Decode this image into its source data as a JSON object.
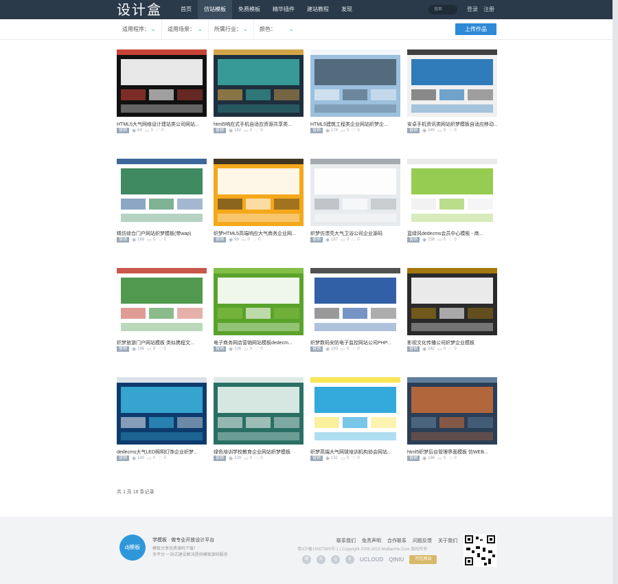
{
  "header": {
    "logo": "设计盒",
    "nav": [
      {
        "label": "首页",
        "active": false
      },
      {
        "label": "仿站模板",
        "active": true
      },
      {
        "label": "免费模板",
        "active": false
      },
      {
        "label": "精华插件",
        "active": false
      },
      {
        "label": "建站教程",
        "active": false
      },
      {
        "label": "发现",
        "active": false
      }
    ],
    "search_placeholder": "搜索",
    "login": "登录",
    "register": "注册"
  },
  "filters": [
    {
      "label": "适用程序：",
      "icon": "chevron-down-icon"
    },
    {
      "label": "适用场景：",
      "icon": "chevron-down-icon"
    },
    {
      "label": "所属行业：",
      "icon": "chevron-down-icon"
    },
    {
      "label": "颜色：",
      "icon": "chevron-down-icon"
    }
  ],
  "upload_button": "上传作品",
  "cards": [
    {
      "title": "HTML5大气网络设计建站类公司网站...",
      "tag": "营销",
      "views": "63",
      "comments": "0",
      "likes": "0",
      "theme": "#ffffff"
    },
    {
      "title": "html5响应式手机自适应资源共享类...",
      "tag": "营销",
      "views": "162",
      "comments": "0",
      "likes": "0",
      "theme": "#2b3e4e"
    },
    {
      "title": "HTML5建筑工程类企业网站织梦企...",
      "tag": "营销",
      "views": "174",
      "comments": "0",
      "likes": "0",
      "theme": "#5b7ea0"
    },
    {
      "title": "安卓手机资讯类网站织梦模板自适应移动...",
      "tag": "营销",
      "views": "245",
      "comments": "0",
      "likes": "0",
      "theme": "#1f6bb0"
    },
    {
      "title": "精仿综合门户网站织梦模板(带wap)",
      "tag": "营销",
      "views": "168",
      "comments": "0",
      "likes": "0",
      "theme": "#1f5a3e"
    },
    {
      "title": "织梦HTML5高端响应大气商务企业网...",
      "tag": "营销",
      "views": "99",
      "comments": "0",
      "likes": "0",
      "theme": "#f2a419"
    },
    {
      "title": "织梦仿漂亮大气卫浴公司企业源码",
      "tag": "营销",
      "views": "187",
      "comments": "0",
      "likes": "0",
      "theme": "#d9dde0"
    },
    {
      "title": "蓝绿风dedecms会员中心模板 - 商...",
      "tag": "营销",
      "views": "158",
      "comments": "0",
      "likes": "0",
      "theme": "#7ab940"
    },
    {
      "title": "织梦旅游门户网站模板 类似携程文...",
      "tag": "营销",
      "views": "198",
      "comments": "0",
      "likes": "0",
      "theme": "#c0392b"
    },
    {
      "title": "电子商务网店营销网站模板dedecm...",
      "tag": "营销",
      "views": "226",
      "comments": "0",
      "likes": "0",
      "theme": "#3f8f2c"
    },
    {
      "title": "织梦数码安防电子监控网站公司PHP...",
      "tag": "营销",
      "views": "193",
      "comments": "0",
      "likes": "0",
      "theme": "#1b4f9c"
    },
    {
      "title": "影视文化传播公司织梦企业模板",
      "tag": "营销",
      "views": "282",
      "comments": "0",
      "likes": "0",
      "theme": "#262626"
    },
    {
      "title": "dedecms大气LED照明灯饰企业织梦...",
      "tag": "营销",
      "views": "140",
      "comments": "0",
      "likes": "0",
      "theme": "#0d3b6e"
    },
    {
      "title": "绿色培训学校教育企业网站织梦模板",
      "tag": "营销",
      "views": "229",
      "comments": "0",
      "likes": "0",
      "theme": "#1e6e60"
    },
    {
      "title": "织梦高端大气网球培训机构协会网站...",
      "tag": "营销",
      "views": "131",
      "comments": "0",
      "likes": "0",
      "theme": "#ffe238"
    },
    {
      "title": "html5织梦后台管理界面模板 仿WEB...",
      "tag": "营销",
      "views": "186",
      "comments": "0",
      "likes": "0",
      "theme": "#334b6b"
    }
  ],
  "pager": "共 1 页 16 条记录",
  "footer": {
    "logo": "dj模板",
    "slogan": "学模板 · 做专业开放设计平台",
    "sub1": "模板分享优质源码下载！",
    "sub2": "多平台 一站式建设解决提供模板源码服务",
    "links": [
      "联系我们",
      "免责声明",
      "合作联系",
      "问题反馈",
      "关于我们"
    ],
    "copyright": "粤ICP备15007995号-1 | Copyright 2008-2018 MoBanHe.Com 版权所有",
    "social": [
      "weibo",
      "wechat",
      "qq",
      "bilibili"
    ],
    "partners": [
      "UCLOUD",
      "QINIU"
    ],
    "badge": "可信网站"
  }
}
